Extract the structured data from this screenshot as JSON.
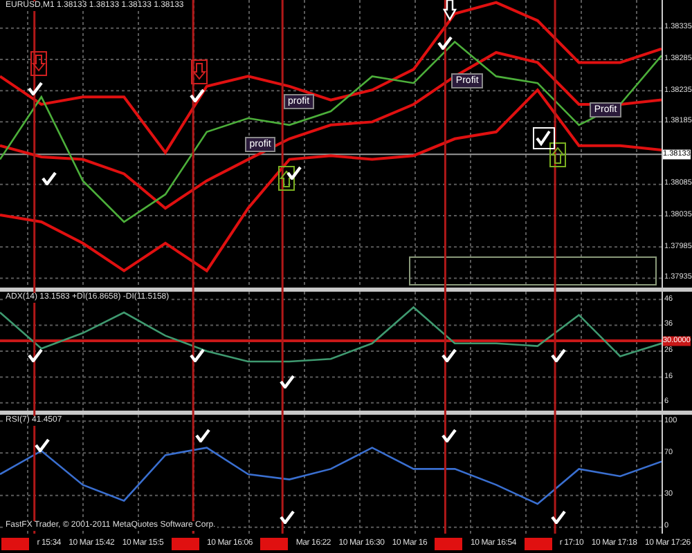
{
  "panes": [
    {
      "title": "EURUSD,M1 1.38133 1.38133 1.38133 1.38133",
      "labels": [
        "profit",
        "profit",
        "Profit",
        "Profit"
      ],
      "chart_data": {
        "type": "line",
        "grid": true,
        "ylim": [
          1.3792,
          1.3838
        ],
        "yticks": [
          1.38335,
          1.38285,
          1.38235,
          1.38185,
          1.38085,
          1.38035,
          1.37985,
          1.37935
        ],
        "series": [
          {
            "color": "#e01010",
            "values": [
              1.38258,
              1.38213,
              1.38225,
              1.38225,
              1.38136,
              1.38242,
              1.38258,
              1.38242,
              1.3822,
              1.38236,
              1.38269,
              1.38358,
              1.38376,
              1.38347,
              1.3828,
              1.3828,
              1.38302
            ]
          },
          {
            "color": "#e01010",
            "values": [
              1.38147,
              1.38129,
              1.38125,
              1.38102,
              1.38047,
              1.38091,
              1.38125,
              1.38158,
              1.3818,
              1.38185,
              1.38213,
              1.38258,
              1.38296,
              1.3828,
              1.38213,
              1.38213,
              1.3822
            ]
          },
          {
            "color": "#e01010",
            "values": [
              1.38036,
              1.38025,
              1.37991,
              1.37947,
              1.37991,
              1.37947,
              1.38047,
              1.38125,
              1.38131,
              1.38125,
              1.38131,
              1.38158,
              1.38169,
              1.38236,
              1.38147,
              1.38147,
              1.3814
            ]
          },
          {
            "color": "#4caf3a",
            "values": [
              1.38125,
              1.38225,
              1.38091,
              1.38025,
              1.38069,
              1.38169,
              1.38191,
              1.3818,
              1.38202,
              1.38258,
              1.38247,
              1.38313,
              1.38258,
              1.38247,
              1.3818,
              1.38213,
              1.38291
            ]
          }
        ],
        "ref_lines": [
          {
            "axis": "y",
            "value": 1.38133,
            "label": "1.38133",
            "color": "#9a9a9a"
          }
        ]
      }
    },
    {
      "title": "ADX(14) 13.1583 +DI(16.8658) -DI(11.5158)",
      "chart_data": {
        "type": "line",
        "grid": true,
        "ylim": [
          3,
          49
        ],
        "yticks": [
          46,
          36,
          26,
          16,
          6
        ],
        "series": [
          {
            "color": "#3f9a70",
            "values": [
              41,
              27,
              33,
              41,
              32,
              26,
              22,
              22,
              23,
              29,
              43,
              29,
              29,
              28,
              40,
              24,
              29
            ]
          }
        ],
        "ref_lines": [
          {
            "axis": "y",
            "value": 30,
            "label": "30.0000",
            "color": "#c81818"
          }
        ]
      }
    },
    {
      "title": "RSI(7) 41.4507",
      "footer": "FastFX Trader, © 2001-2011 MetaQuotes Software Corp.",
      "chart_data": {
        "type": "line",
        "grid": true,
        "ylim": [
          -6,
          106
        ],
        "yticks": [
          100,
          70,
          30,
          0
        ],
        "series": [
          {
            "color": "#3a6fd0",
            "values": [
              50,
              72,
              40,
              25,
              68,
              75,
              50,
              45,
              55,
              75,
              55,
              55,
              40,
              22,
              55,
              48,
              62
            ]
          }
        ]
      }
    }
  ],
  "time_axis": [
    {
      "kind": "cursor"
    },
    {
      "kind": "label",
      "text": "r 15:34"
    },
    {
      "kind": "label",
      "text": "10 Mar 15:42"
    },
    {
      "kind": "label",
      "text": "10 Mar 15:5"
    },
    {
      "kind": "cursor"
    },
    {
      "kind": "label",
      "text": "10 Mar 16:06"
    },
    {
      "kind": "cursor"
    },
    {
      "kind": "label",
      "text": "Mar 16:22"
    },
    {
      "kind": "label",
      "text": "10 Mar 16:30"
    },
    {
      "kind": "label",
      "text": "10 Mar 16"
    },
    {
      "kind": "cursor"
    },
    {
      "kind": "label",
      "text": "10 Mar 16:54"
    },
    {
      "kind": "cursor"
    },
    {
      "kind": "label",
      "text": "r 17:10"
    },
    {
      "kind": "label",
      "text": "10 Mar 17:18"
    },
    {
      "kind": "label",
      "text": "10 Mar 17:26"
    }
  ]
}
